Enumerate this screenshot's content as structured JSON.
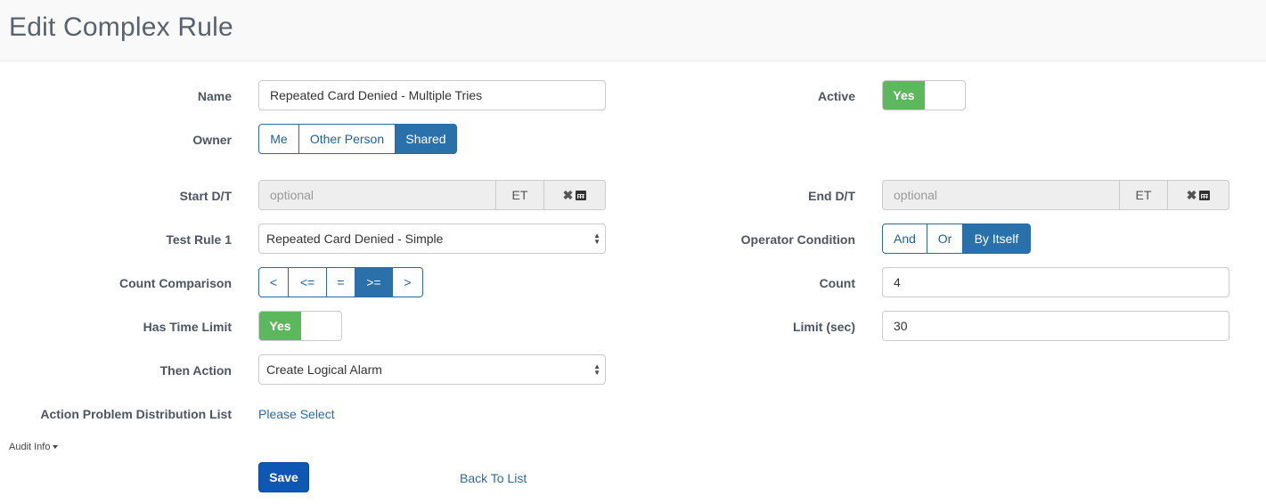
{
  "page": {
    "title": "Edit Complex Rule"
  },
  "form": {
    "name": {
      "label": "Name",
      "value": "Repeated Card Denied - Multiple Tries"
    },
    "active": {
      "label": "Active",
      "value": "Yes"
    },
    "owner": {
      "label": "Owner",
      "options": [
        "Me",
        "Other Person",
        "Shared"
      ],
      "selected": "Shared"
    },
    "start_dt": {
      "label": "Start D/T",
      "placeholder": "optional",
      "timezone": "ET",
      "clear_icon": "times-icon",
      "calendar_icon": "calendar-icon"
    },
    "end_dt": {
      "label": "End D/T",
      "placeholder": "optional",
      "timezone": "ET",
      "clear_icon": "times-icon",
      "calendar_icon": "calendar-icon"
    },
    "test_rule_1": {
      "label": "Test Rule 1",
      "value": "Repeated Card Denied - Simple"
    },
    "operator_condition": {
      "label": "Operator Condition",
      "options": [
        "And",
        "Or",
        "By Itself"
      ],
      "selected": "By Itself"
    },
    "count_comparison": {
      "label": "Count Comparison",
      "options": [
        "<",
        "<=",
        "=",
        ">=",
        ">"
      ],
      "selected": ">="
    },
    "count": {
      "label": "Count",
      "value": "4"
    },
    "has_time_limit": {
      "label": "Has Time Limit",
      "value": "Yes"
    },
    "limit_sec": {
      "label": "Limit (sec)",
      "value": "30"
    },
    "then_action": {
      "label": "Then Action",
      "value": "Create Logical Alarm"
    },
    "distribution_list": {
      "label": "Action Problem Distribution List",
      "link": "Please Select"
    }
  },
  "audit_info": {
    "label": "Audit Info"
  },
  "actions": {
    "save": "Save",
    "back": "Back To List"
  },
  "colors": {
    "primary": "#2a70ab",
    "success": "#5cb85c",
    "save": "#0e57b3",
    "link": "#2a6aa8"
  }
}
